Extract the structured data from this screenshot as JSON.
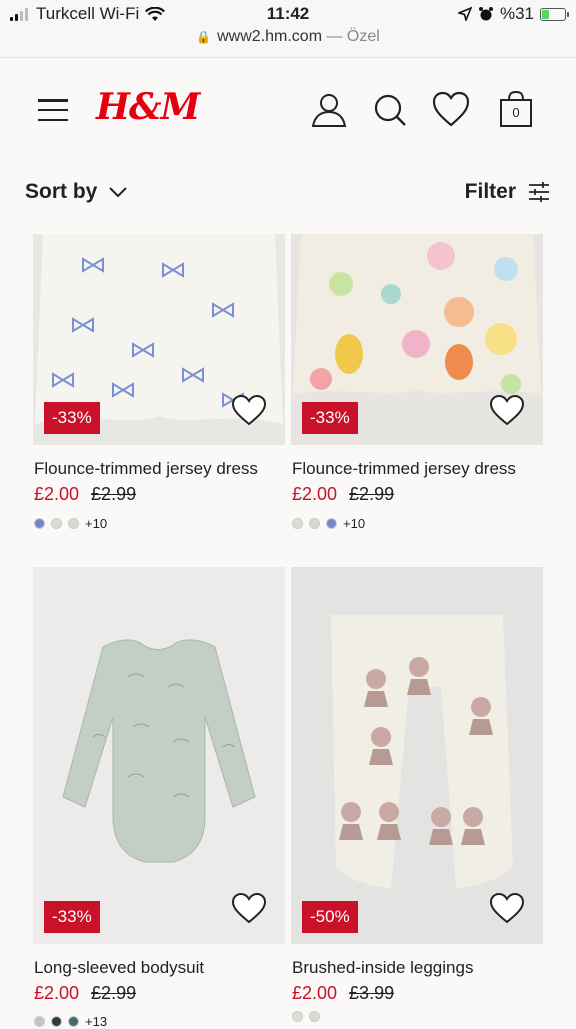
{
  "status": {
    "carrier": "Turkcell Wi-Fi",
    "time": "11:42",
    "battery": "%31",
    "url": "www2.hm.com",
    "url_suffix": "— Özel"
  },
  "header": {
    "logo": "H&M",
    "bag_count": "0"
  },
  "toolbar": {
    "sort_label": "Sort by",
    "filter_label": "Filter"
  },
  "products": [
    {
      "title": "Flounce-trimmed jersey dress",
      "price": "£2.00",
      "old_price": "£2.99",
      "discount": "-33%",
      "swatch_colors": [
        "#7b84c8",
        "#dcdcd6",
        "#d8d8d2"
      ],
      "more_colors": "+10"
    },
    {
      "title": "Flounce-trimmed jersey dress",
      "price": "£2.00",
      "old_price": "£2.99",
      "discount": "-33%",
      "swatch_colors": [
        "#dcdcd6",
        "#d8d8d2",
        "#7b84c8"
      ],
      "more_colors": "+10"
    },
    {
      "title": "Long-sleeved bodysuit",
      "price": "£2.00",
      "old_price": "£2.99",
      "discount": "-33%",
      "swatch_colors": [
        "#bfc7c0",
        "#2f3a40",
        "#4a6670"
      ],
      "more_colors": "+13"
    },
    {
      "title": "Brushed-inside leggings",
      "price": "£2.00",
      "old_price": "£3.99",
      "discount": "-50%",
      "swatch_colors": [
        "#e0ddd6",
        "#dcd9d2"
      ],
      "more_colors": ""
    }
  ]
}
